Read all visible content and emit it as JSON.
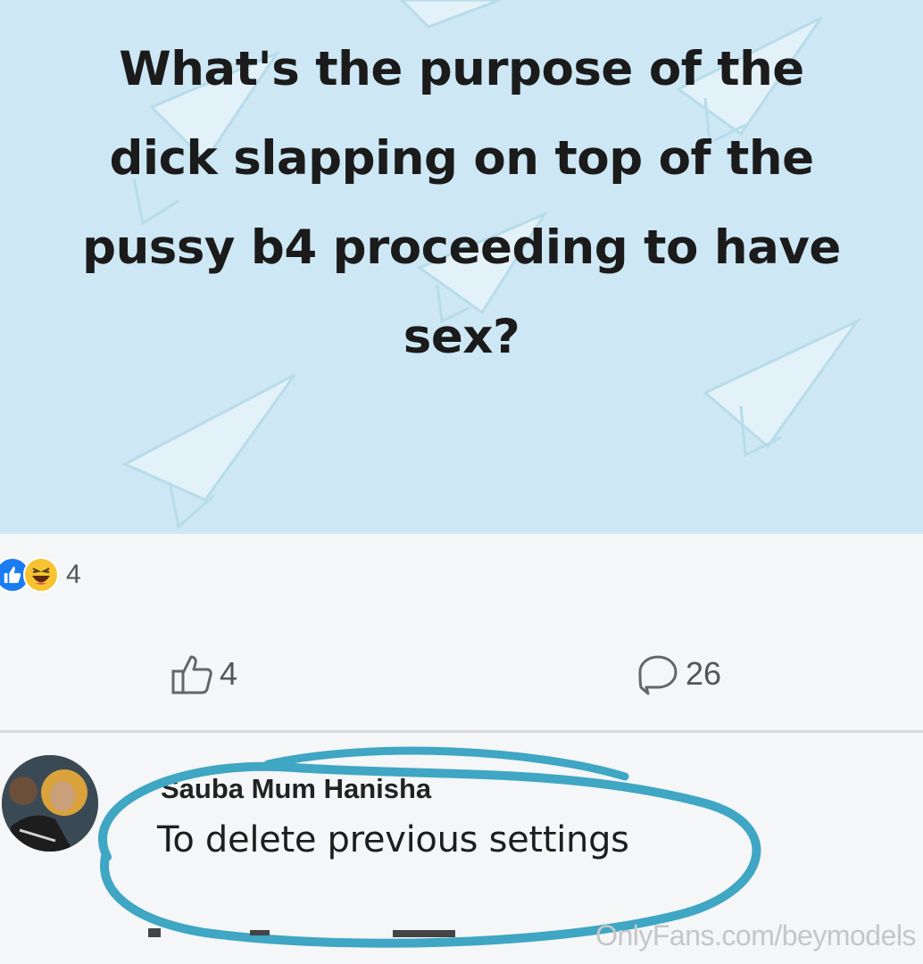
{
  "post": {
    "text_lines": [
      "What's the purpose of the",
      "dick slapping on top of the",
      "pussy b4 proceeding to have",
      "sex?"
    ],
    "background_color": "#cde7f4",
    "background_icon": "paper-plane-icon"
  },
  "reactions": {
    "icons": [
      "like-reaction-icon",
      "haha-reaction-icon"
    ],
    "count": "4"
  },
  "actions": {
    "like_count": "4",
    "comment_count": "26"
  },
  "comment": {
    "author": "Sauba Mum Hanisha",
    "text": "To delete previous settings",
    "highlight_color": "#3fa6c4"
  },
  "watermark": "OnlyFans.com/beymodels"
}
